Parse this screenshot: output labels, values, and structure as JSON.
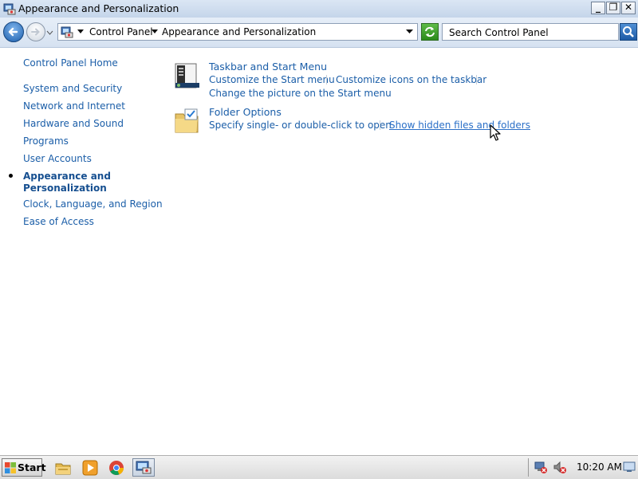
{
  "window": {
    "title": "Appearance and Personalization",
    "minimize_glyph": "_",
    "maximize_glyph": "❐",
    "close_glyph": "✕"
  },
  "address_bar": {
    "breadcrumbs": [
      "Control Panel",
      "Appearance and Personalization"
    ],
    "search_placeholder": "Search Control Panel"
  },
  "left_pane": {
    "home_link": "Control Panel Home",
    "items": [
      "System and Security",
      "Network and Internet",
      "Hardware and Sound",
      "Programs",
      "User Accounts",
      "Appearance and Personalization",
      "Clock, Language, and Region",
      "Ease of Access"
    ],
    "current_index": 5,
    "current_line1": "Appearance and",
    "current_line2": "Personalization"
  },
  "categories": [
    {
      "title": "Taskbar and Start Menu",
      "icon": "taskbar-icon",
      "tasks": [
        "Customize the Start menu",
        "Customize icons on the taskbar",
        "Change the picture on the Start menu"
      ]
    },
    {
      "title": "Folder Options",
      "icon": "folder-options-icon",
      "tasks": [
        "Specify single- or double-click to open",
        "Show hidden files and folders"
      ]
    }
  ],
  "taskbar": {
    "start_label": "Start",
    "pinned_icons": [
      "explorer-icon",
      "media-player-icon",
      "chrome-icon",
      "control-panel-icon"
    ],
    "tray_icons": [
      "network-disconnected-icon",
      "volume-muted-icon"
    ],
    "clock": "10:20 AM"
  },
  "colors": {
    "link": "#1b5ea8",
    "titlebar": "#c4d5ea"
  }
}
